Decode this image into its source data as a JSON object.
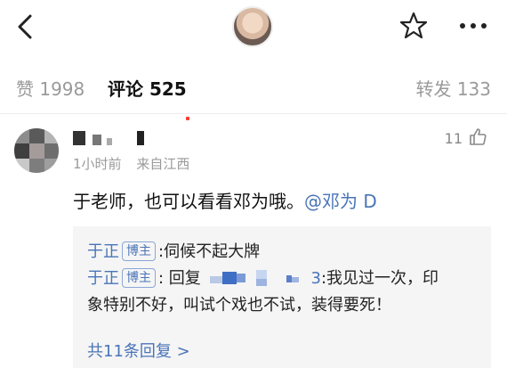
{
  "header": {
    "back_icon": "chevron-left-icon",
    "avatar": "user-avatar",
    "favorite_icon": "star-icon",
    "more_icon": "more-horizontal-icon"
  },
  "tabs": {
    "like": "赞 1998",
    "comment": "评论 525",
    "repost": "转发 133"
  },
  "comment": {
    "username": "",
    "time": "1小时前",
    "location": "来自江西",
    "like_count": "11",
    "text": "于老师，也可以看看邓为哦。",
    "mention": "@邓为 D"
  },
  "replies": [
    {
      "user": "于正",
      "badge": "博主",
      "prefix": ":",
      "text": "伺候不起大牌"
    },
    {
      "user": "于正",
      "badge": "博主",
      "prefix": ": 回复",
      "target_suffix": "3",
      "text_line1": ":我见过一次，印",
      "text_line2": "象特别不好，叫试个戏也不试，装得要死！"
    }
  ],
  "more_replies": "共11条回复 >",
  "colors": {
    "link": "#4a74b8",
    "accent_indicator": "#ff3b30",
    "muted": "#9a9a9a"
  }
}
